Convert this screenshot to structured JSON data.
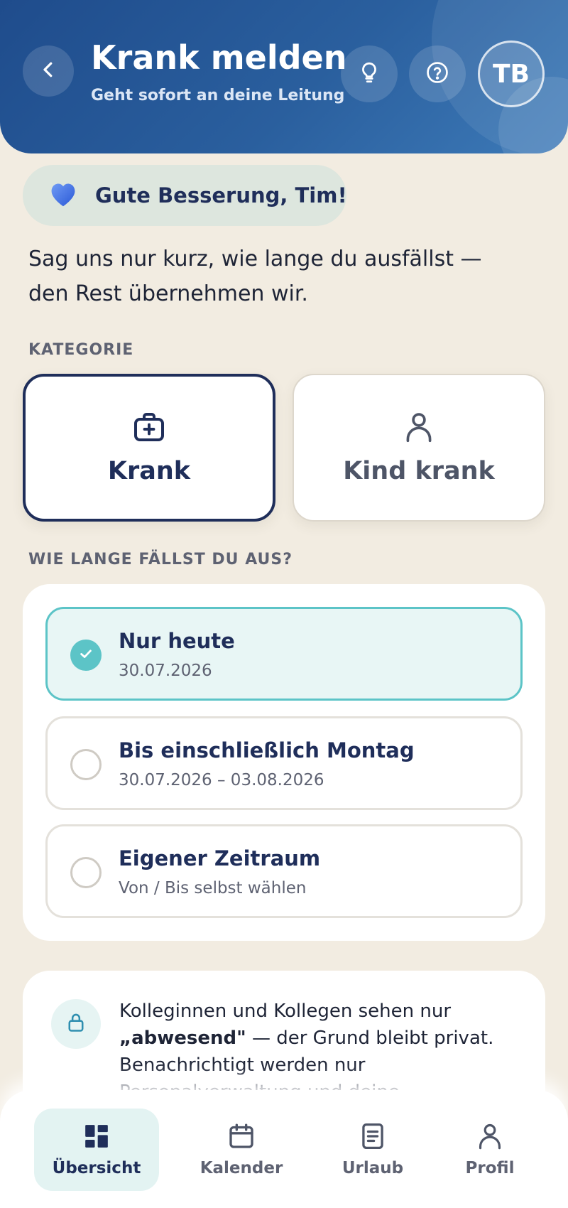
{
  "header": {
    "title": "Krank melden",
    "subtitle": "Geht sofort an deine Leitung",
    "avatar_initials": "TB",
    "icons": [
      "chevron-left-icon",
      "lightbulb-icon",
      "help-circle-icon"
    ]
  },
  "greeting": {
    "text": "Gute Besserung, Tim!",
    "icon": "blue-heart-icon"
  },
  "intro": "Sag uns nur kurz, wie lange du ausfällst — den Rest übernehmen wir.",
  "category": {
    "label": "KATEGORIE",
    "options": [
      {
        "label": "Krank",
        "icon": "medical-bag-icon",
        "selected": true
      },
      {
        "label": "Kind krank",
        "icon": "person-icon",
        "selected": false
      }
    ]
  },
  "duration": {
    "label": "WIE LANGE FÄLLST DU AUS?",
    "options": [
      {
        "title": "Nur heute",
        "subtitle": "30.07.2026",
        "selected": true
      },
      {
        "title": "Bis einschließlich Montag",
        "subtitle": "30.07.2026 – 03.08.2026",
        "selected": false
      },
      {
        "title": "Eigener Zeitraum",
        "subtitle": "Von / Bis selbst wählen",
        "selected": false
      }
    ]
  },
  "privacy": {
    "text_before": "Kolleginnen und Kollegen sehen nur",
    "highlight": "„abwesend\"",
    "text_after": "— der Grund bleibt privat.",
    "line3": "Benachrichtigt werden nur",
    "line4": "Personalverwaltung und deine",
    "icon": "lock-icon"
  },
  "nav": {
    "items": [
      {
        "label": "Übersicht",
        "icon": "dashboard-icon",
        "active": true
      },
      {
        "label": "Kalender",
        "icon": "calendar-icon",
        "active": false
      },
      {
        "label": "Urlaub",
        "icon": "document-icon",
        "active": false
      },
      {
        "label": "Profil",
        "icon": "user-icon",
        "active": false
      }
    ]
  },
  "colors": {
    "header_start": "#1f4c8c",
    "header_end": "#3d7ab8",
    "background": "#f2ece1",
    "primary_navy": "#1f2e5a",
    "accent_teal": "#5cc4c7",
    "heart_blue": "#3b6ee8"
  }
}
